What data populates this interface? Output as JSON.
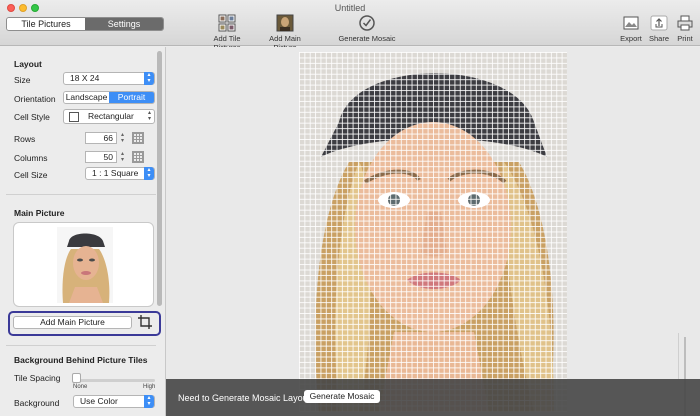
{
  "window": {
    "title": "Untitled"
  },
  "tabs": [
    {
      "label": "Tile Pictures",
      "active": true
    },
    {
      "label": "Settings",
      "active": false
    }
  ],
  "toolbar": {
    "add_tile_label": "Add Tile Pictures",
    "add_main_label": "Add Main Picture",
    "generate_label": "Generate Mosaic",
    "export_label": "Export",
    "share_label": "Share",
    "print_label": "Print"
  },
  "layout": {
    "title": "Layout",
    "size_label": "Size",
    "size_value": "18 X 24",
    "orientation_label": "Orientation",
    "orientation_options": [
      "Landscape",
      "Portrait"
    ],
    "orientation_selected": "Portrait",
    "cell_style_label": "Cell Style",
    "cell_style_value": "Rectangular",
    "rows_label": "Rows",
    "rows_value": "66",
    "columns_label": "Columns",
    "columns_value": "50",
    "cell_size_label": "Cell Size",
    "cell_size_value": "1 : 1 Square"
  },
  "main_picture": {
    "title": "Main Picture",
    "add_button": "Add Main Picture"
  },
  "background": {
    "title": "Background Behind Picture Tiles",
    "tile_spacing_label": "Tile Spacing",
    "slider_min": "None",
    "slider_max": "High",
    "tile_spacing_level": 0.0,
    "background_label": "Background",
    "background_value": "Use Color"
  },
  "status": {
    "message": "Need to Generate Mosaic Layout",
    "button": "Generate Mosaic"
  },
  "colors": {
    "accent": "#3d8ef6",
    "highlight": "#3b3a98",
    "bottom_bar": "#464646"
  }
}
